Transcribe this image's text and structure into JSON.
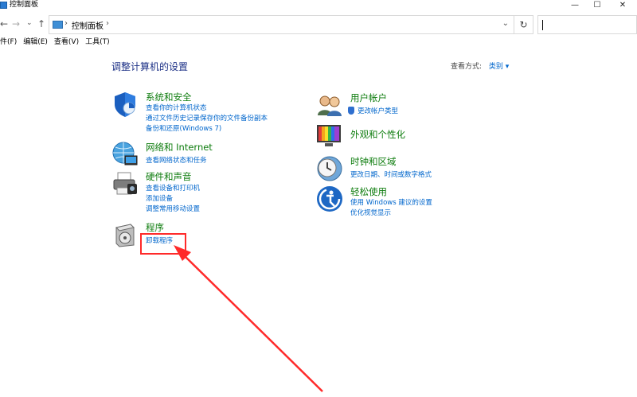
{
  "window": {
    "title": "控制面板",
    "minimize": "—",
    "maximize": "☐",
    "close": "✕"
  },
  "nav": {
    "back": "←",
    "forward": "→",
    "recent": "⌄",
    "up": "↑",
    "breadcrumb": "控制面板",
    "separator": "›",
    "dropdown": "⌄",
    "refresh": "↻"
  },
  "menu": [
    "件(F)",
    "编辑(E)",
    "查看(V)",
    "工具(T)"
  ],
  "main": {
    "heading": "调整计算机的设置",
    "view_label": "查看方式:",
    "view_value": "类别 ▾"
  },
  "categories": {
    "system": {
      "title": "系统和安全",
      "links": [
        "查看你的计算机状态",
        "通过文件历史记录保存你的文件备份副本",
        "备份和还原(Windows 7)"
      ]
    },
    "network": {
      "title": "网络和 Internet",
      "links": [
        "查看网络状态和任务"
      ]
    },
    "hardware": {
      "title": "硬件和声音",
      "links": [
        "查看设备和打印机",
        "添加设备",
        "调整常用移动设置"
      ]
    },
    "programs": {
      "title": "程序",
      "links": [
        "卸载程序"
      ]
    },
    "users": {
      "title": "用户帐户",
      "links": [
        "更改帐户类型"
      ]
    },
    "appearance": {
      "title": "外观和个性化",
      "links": []
    },
    "clock": {
      "title": "时钟和区域",
      "links": [
        "更改日期、时间或数字格式"
      ]
    },
    "ease": {
      "title": "轻松使用",
      "links": [
        "使用 Windows 建议的设置",
        "优化视觉显示"
      ]
    }
  },
  "colors": {
    "category_title": "#0d7c0d",
    "link": "#0066cc",
    "heading": "#1e3287",
    "annotation": "#ff2a2a"
  }
}
